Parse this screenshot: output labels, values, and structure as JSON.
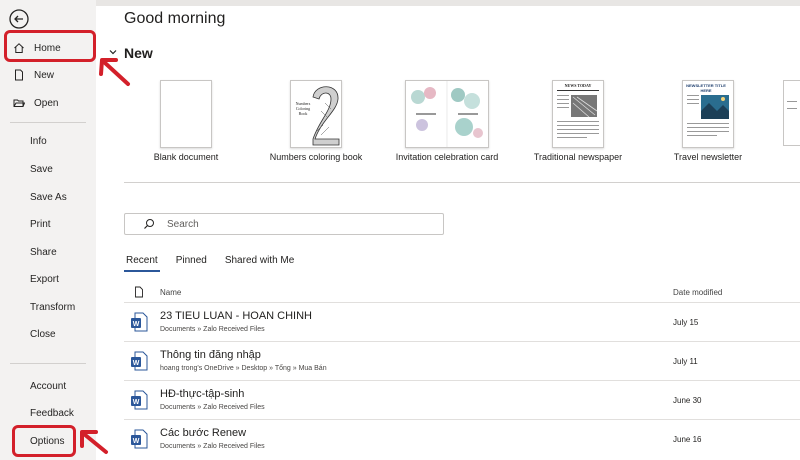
{
  "main": {
    "greeting": "Good morning",
    "new_section": {
      "title": "New",
      "templates": [
        {
          "label": "Blank document"
        },
        {
          "label": "Numbers coloring book",
          "thumb_text": "Numbers Coloring Book"
        },
        {
          "label": "Invitation celebration card"
        },
        {
          "label": "Traditional newspaper",
          "thumb_text": "NEWS TODAY"
        },
        {
          "label": "Travel newsletter",
          "thumb_text": "NEWSLETTER TITLE HERE"
        }
      ]
    },
    "search": {
      "placeholder": "Search"
    },
    "tabs": [
      "Recent",
      "Pinned",
      "Shared with Me"
    ],
    "columns": {
      "name": "Name",
      "date": "Date modified"
    },
    "files": [
      {
        "name": "23 TIEU LUAN - HOAN CHINH",
        "path": "Documents » Zalo Received Files",
        "date": "July 15"
      },
      {
        "name": "Thông tin đăng nhập",
        "path": "hoang trong's OneDrive » Desktop » Tổng » Mua Bán",
        "date": "July 11"
      },
      {
        "name": "HĐ-thực-tập-sinh",
        "path": "Documents » Zalo Received Files",
        "date": "June 30"
      },
      {
        "name": "Các bước Renew",
        "path": "Documents » Zalo Received Files",
        "date": "June 16"
      }
    ]
  },
  "sidebar": {
    "primary": [
      {
        "label": "Home",
        "icon": "home-icon"
      },
      {
        "label": "New",
        "icon": "new-document-icon"
      },
      {
        "label": "Open",
        "icon": "folder-open-icon"
      }
    ],
    "secondary": [
      "Info",
      "Save",
      "Save As",
      "Print",
      "Share",
      "Export",
      "Transform",
      "Close"
    ],
    "bottom": [
      "Account",
      "Feedback",
      "Options"
    ]
  },
  "colors": {
    "highlight": "#d3202a",
    "word_blue": "#2b579a",
    "sidebar_bg": "#f3f2f1"
  }
}
